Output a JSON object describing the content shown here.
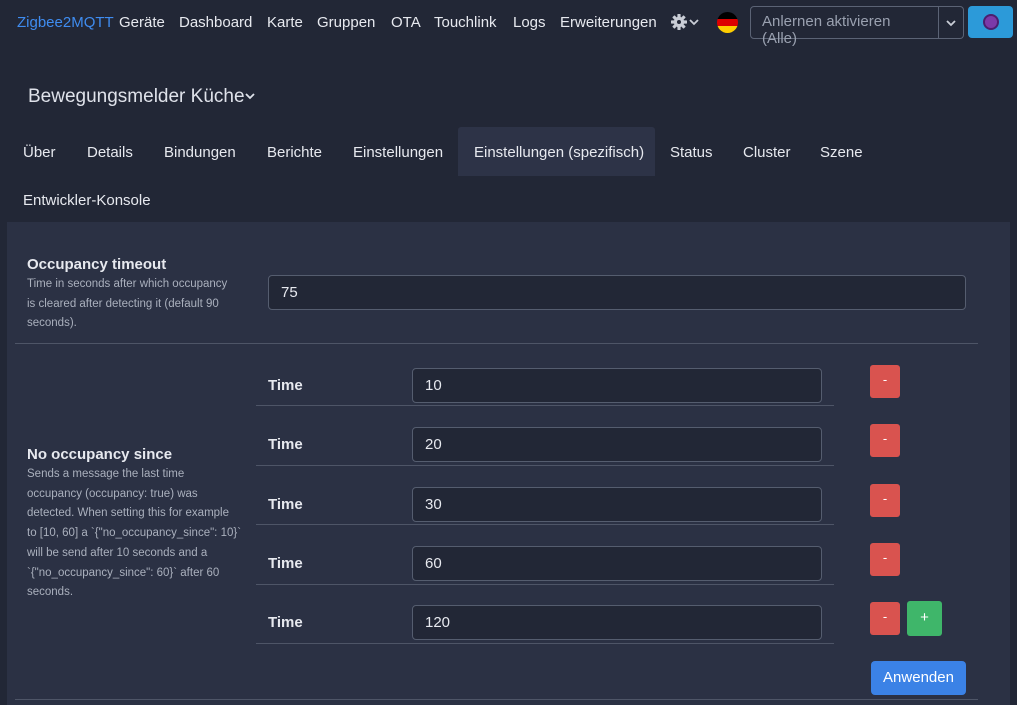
{
  "navbar": {
    "brand": "Zigbee2MQTT",
    "links": [
      "Geräte",
      "Dashboard",
      "Karte",
      "Gruppen",
      "OTA",
      "Touchlink",
      "Logs",
      "Erweiterungen"
    ],
    "settings_icon": "gear-icon",
    "language_icon": "germany-flag-icon",
    "permit_join_label": "Anlernen aktivieren (Alle)",
    "notifications_icon": "notification-dot-icon"
  },
  "device": {
    "title": "Bewegungsmelder Küche"
  },
  "tabs": [
    "Über",
    "Details",
    "Bindungen",
    "Berichte",
    "Einstellungen",
    "Einstellungen (spezifisch)",
    "Status",
    "Cluster",
    "Szene",
    "Entwickler-Konsole"
  ],
  "active_tab": "Einstellungen (spezifisch)",
  "settings": {
    "occupancy_timeout": {
      "title": "Occupancy timeout",
      "desc_lines": [
        "Time in seconds after which occupancy",
        "is cleared after detecting it (default 90",
        "seconds)."
      ],
      "value": "75"
    },
    "no_occupancy_since": {
      "title": "No occupancy since",
      "desc_lines": [
        "Sends a message the last time",
        "occupancy (occupancy: true) was",
        "detected. When setting this for example",
        "to [10, 60] a `{\"no_occupancy_since\": 10}`",
        "will be send after 10 seconds and a",
        "`{\"no_occupancy_since\": 60}` after 60",
        "seconds."
      ],
      "item_label": "Time",
      "values": [
        "10",
        "20",
        "30",
        "60",
        "120"
      ],
      "remove_label": "-",
      "add_label": "+"
    },
    "apply_label": "Anwenden"
  },
  "colors": {
    "background": "#222736",
    "panel": "#2b3144",
    "brand": "#3f8cf0",
    "danger": "#d9534f",
    "success": "#3fb66a",
    "primary": "#3b82e6"
  }
}
